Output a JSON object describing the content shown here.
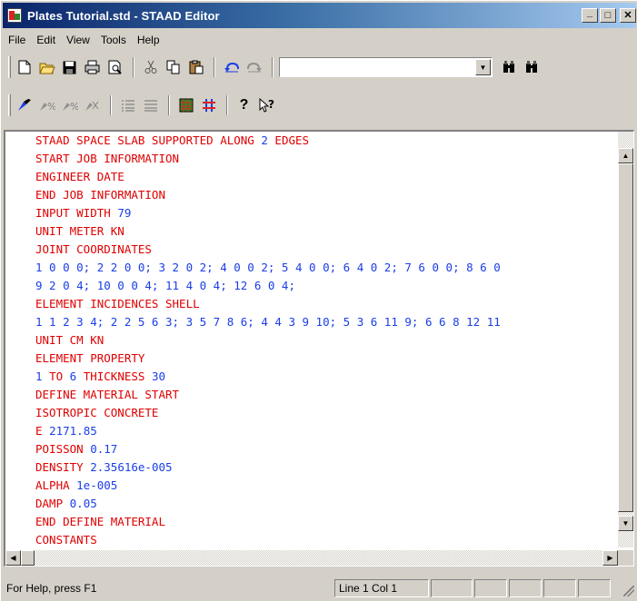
{
  "window": {
    "title": "Plates Tutorial.std - STAAD Editor",
    "controls": {
      "minimize": "_",
      "maximize": "□",
      "close": "✕"
    }
  },
  "menu": [
    "File",
    "Edit",
    "View",
    "Tools",
    "Help"
  ],
  "toolbar1": {
    "icons": [
      "new-file-icon",
      "open-folder-icon",
      "save-icon",
      "print-icon",
      "print-preview-icon",
      "cut-icon",
      "copy-icon",
      "paste-icon",
      "undo-icon",
      "redo-icon"
    ],
    "search_value": "",
    "find_icons": [
      "find-icon",
      "find-next-icon"
    ]
  },
  "toolbar2": {
    "icons": [
      "set-bookmark-icon",
      "next-bookmark-icon",
      "prev-bookmark-icon",
      "clear-bookmarks-icon",
      "indent-icon",
      "outdent-icon",
      "calculator-icon",
      "syntax-check-icon",
      "help-icon",
      "context-help-icon"
    ]
  },
  "editor": {
    "lines": [
      {
        "type": "kw",
        "text": "STAAD SPACE SLAB SUPPORTED ALONG ",
        "tail": "2",
        "tail2": " EDGES"
      },
      {
        "type": "kw",
        "text": "START JOB INFORMATION"
      },
      {
        "type": "kw",
        "text": "ENGINEER DATE"
      },
      {
        "type": "kw",
        "text": "END JOB INFORMATION"
      },
      {
        "type": "kw",
        "text": "INPUT WIDTH ",
        "tail": "79"
      },
      {
        "type": "kw",
        "text": "UNIT METER KN"
      },
      {
        "type": "kw",
        "text": "JOINT COORDINATES"
      },
      {
        "type": "num",
        "text": "1 0 0 0; 2 2 0 0; 3 2 0 2; 4 0 0 2; 5 4 0 0; 6 4 0 2; 7 6 0 0; 8 6 0"
      },
      {
        "type": "num",
        "text": "9 2 0 4; 10 0 0 4; 11 4 0 4; 12 6 0 4;"
      },
      {
        "type": "kw",
        "text": "ELEMENT INCIDENCES SHELL"
      },
      {
        "type": "num",
        "text": "1 1 2 3 4; 2 2 5 6 3; 3 5 7 8 6; 4 4 3 9 10; 5 3 6 11 9; 6 6 8 12 11"
      },
      {
        "type": "kw",
        "text": "UNIT CM KN"
      },
      {
        "type": "kw",
        "text": "ELEMENT PROPERTY"
      },
      {
        "type": "mix",
        "text": "1 TO 6 THICKNESS 30"
      },
      {
        "type": "kw",
        "text": "DEFINE MATERIAL START"
      },
      {
        "type": "kw",
        "text": "ISOTROPIC CONCRETE"
      },
      {
        "type": "kw",
        "text": "E ",
        "tail": "2171.85"
      },
      {
        "type": "kw",
        "text": "POISSON ",
        "tail": "0.17"
      },
      {
        "type": "kw",
        "text": "DENSITY ",
        "tail": "2.35616e-005"
      },
      {
        "type": "kw",
        "text": "ALPHA ",
        "tail": "1e-005"
      },
      {
        "type": "kw",
        "text": "DAMP ",
        "tail": "0.05"
      },
      {
        "type": "kw",
        "text": "END DEFINE MATERIAL"
      },
      {
        "type": "kw",
        "text": "CONSTANTS"
      }
    ]
  },
  "status": {
    "help": "For Help, press F1",
    "position": "Line    1 Col   1"
  },
  "colors": {
    "keyword": "#e00000",
    "number": "#1a3ee8",
    "title_start": "#0a246a",
    "title_end": "#a6caf0"
  }
}
